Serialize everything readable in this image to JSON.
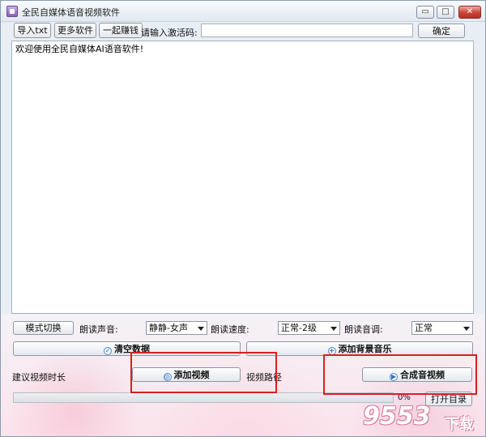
{
  "window": {
    "title": "全民自媒体语音视频软件",
    "minimize_glyph": "▭",
    "maximize_glyph": "□",
    "close_glyph": "✕"
  },
  "toolbar": {
    "import_label": "导入txt",
    "more_label": "更多软件",
    "earn_label": "一起赚钱",
    "code_label": "请输入激活码:",
    "code_value": "",
    "confirm_label": "确定"
  },
  "editor": {
    "text": "欢迎使用全民自媒体AI语音软件!"
  },
  "controls": {
    "mode_label": "模式切换",
    "voice_label": "朗读声音:",
    "voice_value": "静静-女声",
    "speed_label": "朗读速度:",
    "speed_value": "正常-2级",
    "tone_label": "朗读音调:",
    "tone_value": "正常"
  },
  "actions": {
    "clear_label": "清空数据",
    "bgm_label": "添加背景音乐",
    "duration_label": "建议视频时长",
    "add_video_label": "添加视频",
    "path_label": "视频路径",
    "compose_label": "合成音视频",
    "progress_percent": 0,
    "progress_text": "0%",
    "open_dir_label": "打开目录"
  },
  "watermark": {
    "text": "9553",
    "sub": "下载"
  },
  "colors": {
    "highlight": "#d82020",
    "progress": "#3fa84d"
  }
}
